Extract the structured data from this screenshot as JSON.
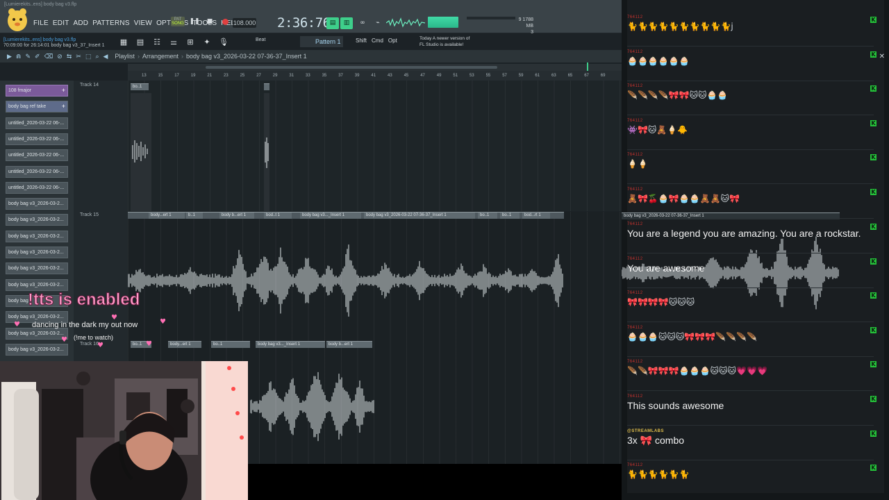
{
  "app": {
    "project_file": "[Lumierekits..ens] body bag v3.flp",
    "menu": [
      "FILE",
      "EDIT",
      "ADD",
      "PATTERNS",
      "VIEW",
      "OPTIONS",
      "TOOLS",
      "HELP"
    ],
    "tempo": "108.000",
    "timecode": "2:36:76",
    "memory": "1788 MB",
    "memory_sub": "3",
    "cpu_num": "9",
    "pattern_song": [
      "PAT",
      "SONG"
    ],
    "project_time": "70:09:00 for 26:14:01",
    "project_hint": "body bag v3_37_Insert 1",
    "snap_label": "Beat",
    "pattern_label": "Pattern 1",
    "mod_keys": [
      "Shift",
      "Cmd",
      "Opt"
    ],
    "news_line1": "Today  A newer version of",
    "news_line2": "FL Studio is available!"
  },
  "playlist": {
    "title": "Playlist",
    "view": "Arrangement",
    "clip": "body bag v3_2026-03-22 07-36-37_Insert 1",
    "ruler_numbers": [
      "13",
      "15",
      "17",
      "19",
      "21",
      "23",
      "25",
      "27",
      "29",
      "31",
      "33",
      "35",
      "37",
      "39",
      "41",
      "43",
      "45",
      "47",
      "49",
      "51",
      "53",
      "55",
      "57",
      "59",
      "61",
      "63",
      "65",
      "67",
      "69"
    ],
    "patterns": [
      "108 fmajor",
      "body bag ref take",
      "untitled_2026-03-22 06-...",
      "untitled_2026-03-22 06-...",
      "untitled_2026-03-22 06-...",
      "untitled_2026-03-22 06-...",
      "untitled_2026-03-22 06-...",
      "body bag v3_2026-03-2...",
      "body bag v3_2026-03-2...",
      "body bag v3_2026-03-2...",
      "body bag v3_2026-03-2...",
      "body bag v3_2026-03-2...",
      "body bag v3_2026-03-2...",
      "body bag",
      "body bag v3_2026-03-2...",
      "body bag v3_2026-03-2...",
      "body bag v3_2026-03-2..."
    ],
    "tracks": [
      {
        "label": "Track 14",
        "clips": [
          "bo..1",
          ""
        ]
      },
      {
        "label": "Track 15",
        "clips": [
          "body...ert 1",
          "b..1",
          "body b...ert 1",
          "bod..t 1",
          "body bag v3..._Insert 1",
          "body bag v3_2026-03-22 07-36-37_Insert 1",
          "bo..1",
          "bo..1",
          "bod...rt 1"
        ]
      },
      {
        "label": "Track 16",
        "clips": [
          "bo..1",
          "body...ert 1",
          "bo..1",
          "body bag v3..._Insert 1",
          "body b...ert 1"
        ]
      }
    ],
    "ghost_clip": "body bag v3_2026-03-22 07-36-37_Insert 1"
  },
  "chat": {
    "messages": [
      {
        "user": "764112",
        "text": "",
        "emotes": "🐈🐈🐈🐈🐈🐈🐈🐈🐈🐈j"
      },
      {
        "user": "764112",
        "text": "",
        "emotes": "🧁🧁🧁🧁🧁🧁"
      },
      {
        "user": "764112",
        "text": "",
        "emotes": "🪶🪶🪶🪶🎀🎀🐱🐱🧁🧁"
      },
      {
        "user": "764112",
        "text": "",
        "emotes": "👾🎀🐱🧸🍦🐥"
      },
      {
        "user": "764112",
        "text": "",
        "emotes": "🍦🍦"
      },
      {
        "user": "764112",
        "text": "",
        "emotes": "🧸🎀🍒🧁🎀🧁🧁🧸🧸🐱🎀"
      },
      {
        "user": "764112",
        "text": "You are a legend you are amazing. You are a rockstar.",
        "emotes": ""
      },
      {
        "user": "764112",
        "text": "You are awesome",
        "emotes": ""
      },
      {
        "user": "764112",
        "text": "",
        "emotes": "🎀🎀🎀🎀🐱🐱🐱"
      },
      {
        "user": "764112",
        "text": "",
        "emotes": "🧁🧁🧁🐱🐱🐱🎀🎀🎀🪶🪶🪶🪶"
      },
      {
        "user": "764112",
        "text": "",
        "emotes": "🪶🪶🎀🎀🎀🧁🧁🧁🐱🐱🐱💗💗💗"
      },
      {
        "user": "764112",
        "text": "This sounds awesome",
        "emotes": ""
      },
      {
        "user": "@STREAMLABS",
        "text": "3x 🎀 combo",
        "emotes": ""
      },
      {
        "user": "764112",
        "text": "",
        "emotes": "🐈🐈🐈🐈🐈🐈"
      }
    ]
  },
  "overlay": {
    "tts": "!tts is enabled",
    "now_playing": "dancing in the dark my out now",
    "watch": "(!me to watch)"
  },
  "colors": {
    "accent_green": "#3ecf8b",
    "kick_badge": "#25c23a",
    "chat_user": "#c8322e",
    "tts_pink": "#ff9bc8"
  }
}
